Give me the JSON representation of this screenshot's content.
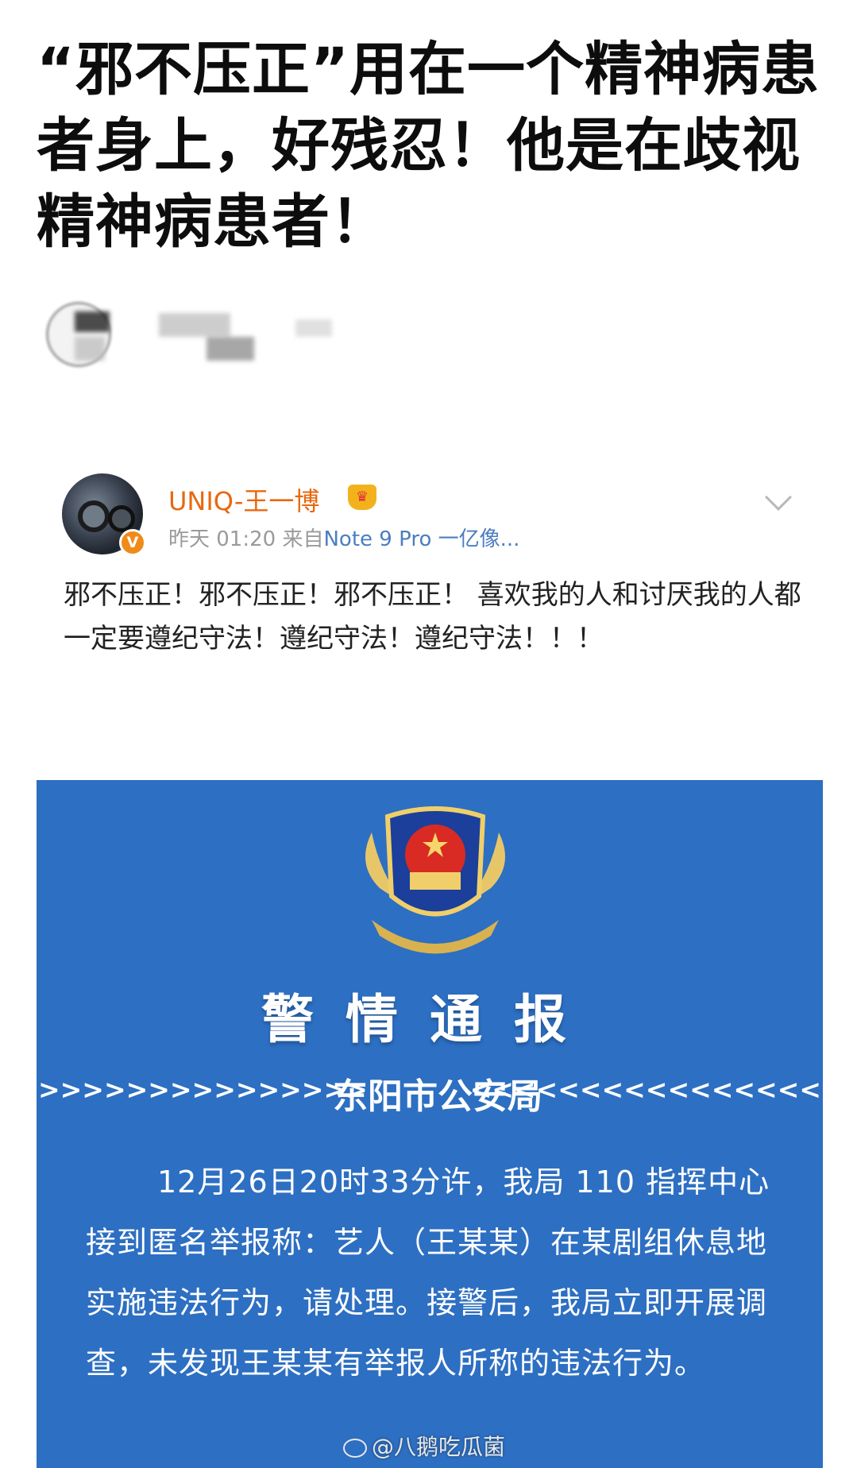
{
  "headline": "“邪不压正”用在一个精神病患者身上，好残忍！他是在歧视精神病患者！",
  "post": {
    "username": "UNIQ-王一博",
    "verified_badge": "V",
    "time": "昨天 01:20",
    "source_prefix": "来自",
    "source_device": "Note 9 Pro 一亿像...",
    "text": "邪不压正！邪不压正！邪不压正！ 喜欢我的人和讨厌我的人都一定要遵纪守法！遵纪守法！遵纪守法！！！"
  },
  "notice": {
    "title": "警情通报",
    "arrows_left": ">>>>>>>>>>>>>>>",
    "arrows_right": "<<<<<<<<<<<<<<<<",
    "bureau": "东阳市公安局",
    "body": "12月26日20时33分许，我局 110 指挥中心接到匿名举报称：艺人（王某某）在某剧组休息地实施违法行为，请处理。接警后，我局立即开展调查，未发现王某某有举报人所称的违法行为。",
    "background_color": "#2d6fc2"
  },
  "watermark": "@八鹅吃瓜菌"
}
